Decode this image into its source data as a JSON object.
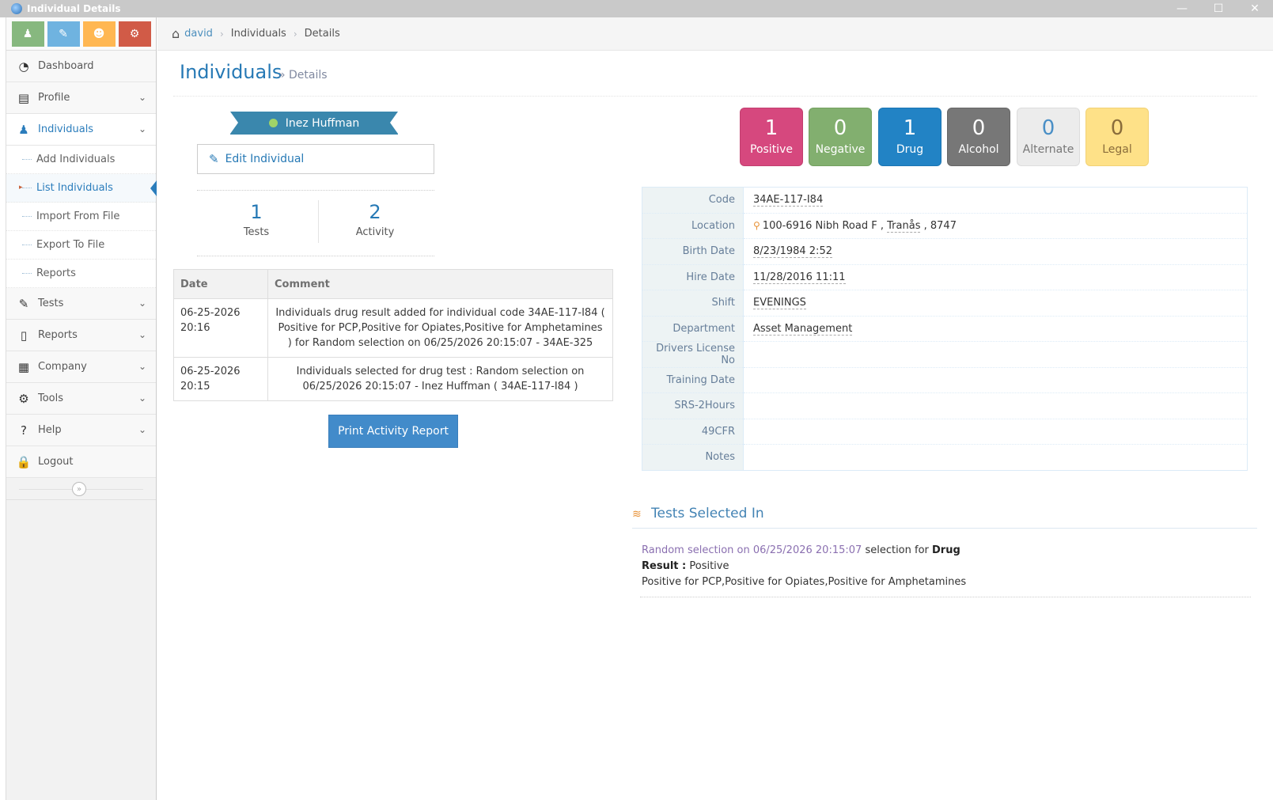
{
  "window": {
    "title": "Individual Details",
    "buttons": {
      "minimize": "—",
      "maximize": "☐",
      "close": "✕"
    }
  },
  "sidebar": {
    "shortcuts": [
      {
        "name": "individual",
        "glyph": "♟"
      },
      {
        "name": "edit",
        "glyph": "✎"
      },
      {
        "name": "group",
        "glyph": "☻"
      },
      {
        "name": "settings",
        "glyph": "⚙"
      }
    ],
    "items": [
      {
        "label": "Dashboard",
        "icon": "dashboard-icon",
        "glyph": "◔"
      },
      {
        "label": "Profile",
        "icon": "profile-card-icon",
        "glyph": "▤"
      },
      {
        "label": "Individuals",
        "icon": "person-icon",
        "glyph": "♟"
      },
      {
        "label": "Tests",
        "icon": "edit-icon",
        "glyph": "✎"
      },
      {
        "label": "Reports",
        "icon": "pdf-icon",
        "glyph": "▯"
      },
      {
        "label": "Company",
        "icon": "building-icon",
        "glyph": "▦"
      },
      {
        "label": "Tools",
        "icon": "gears-icon",
        "glyph": "⚙"
      },
      {
        "label": "Help",
        "icon": "help-icon",
        "glyph": "?"
      },
      {
        "label": "Logout",
        "icon": "lock-icon",
        "glyph": "🔒"
      }
    ],
    "individuals_submenu": [
      "Add Individuals",
      "List Individuals",
      "Import From File",
      "Export To File",
      "Reports"
    ],
    "collapse_glyph": "»"
  },
  "breadcrumb": {
    "home": "david",
    "level1": "Individuals",
    "level2": "Details",
    "sep": "›"
  },
  "page_header": {
    "title": "Individuals",
    "subtitle": "» Details"
  },
  "profile": {
    "name": "Inez Huffman",
    "edit_label": "Edit Individual",
    "stats": [
      {
        "value": "1",
        "label": "Tests"
      },
      {
        "value": "2",
        "label": "Activity"
      }
    ]
  },
  "activity": {
    "headers": [
      "Date",
      "Comment"
    ],
    "rows": [
      {
        "date": "06-25-2026 20:16",
        "comment": "Individuals drug result added for individual code 34AE-117-I84 ( Positive for PCP,Positive for Opiates,Positive for Amphetamines ) for Random selection on 06/25/2026 20:15:07 - 34AE-325"
      },
      {
        "date": "06-25-2026 20:15",
        "comment": "Individuals selected for drug test : Random selection on 06/25/2026 20:15:07 - Inez Huffman ( 34AE-117-I84 )"
      }
    ],
    "print_label": "Print Activity Report"
  },
  "counts": [
    {
      "value": "1",
      "label": "Positive",
      "color": "#d6487e"
    },
    {
      "value": "0",
      "label": "Negative",
      "color": "#82af6f"
    },
    {
      "value": "1",
      "label": "Drug",
      "color": "#2283c5"
    },
    {
      "value": "0",
      "label": "Alcohol",
      "color": "#777777"
    },
    {
      "value": "0",
      "label": "Alternate",
      "color": "#ececec"
    },
    {
      "value": "0",
      "label": "Legal",
      "color": "#fee188"
    }
  ],
  "info": {
    "code": {
      "label": "Code",
      "value": "34AE-117-I84"
    },
    "location": {
      "label": "Location",
      "street": "100-6916 Nibh Road F",
      "city": "Tranås",
      "zip": "8747",
      "sep": ",",
      "pin": "⚲"
    },
    "birth_date": {
      "label": "Birth Date",
      "value": "8/23/1984 2:52"
    },
    "hire_date": {
      "label": "Hire Date",
      "value": "11/28/2016 11:11"
    },
    "shift": {
      "label": "Shift",
      "value": "EVENINGS"
    },
    "department": {
      "label": "Department",
      "value": "Asset Management"
    },
    "drivers_license": {
      "label": "Drivers License No",
      "value": ""
    },
    "training_date": {
      "label": "Training Date",
      "value": ""
    },
    "srs": {
      "label": "SRS-2Hours",
      "value": ""
    },
    "cfr": {
      "label": "49CFR",
      "value": ""
    },
    "notes": {
      "label": "Notes",
      "value": ""
    }
  },
  "tests_selected": {
    "title": "Tests Selected In",
    "rss_glyph": "≋",
    "selection": "Random selection on 06/25/2026 20:15:07",
    "selection_for": "selection for",
    "test_type": "Drug",
    "result_label": "Result :",
    "result_value": "Positive",
    "details": "Positive for PCP,Positive for Opiates,Positive for Amphetamines"
  },
  "icons": {
    "home": "⌂",
    "chevron": "⌄",
    "edit": "✎",
    "caret": "▸"
  }
}
